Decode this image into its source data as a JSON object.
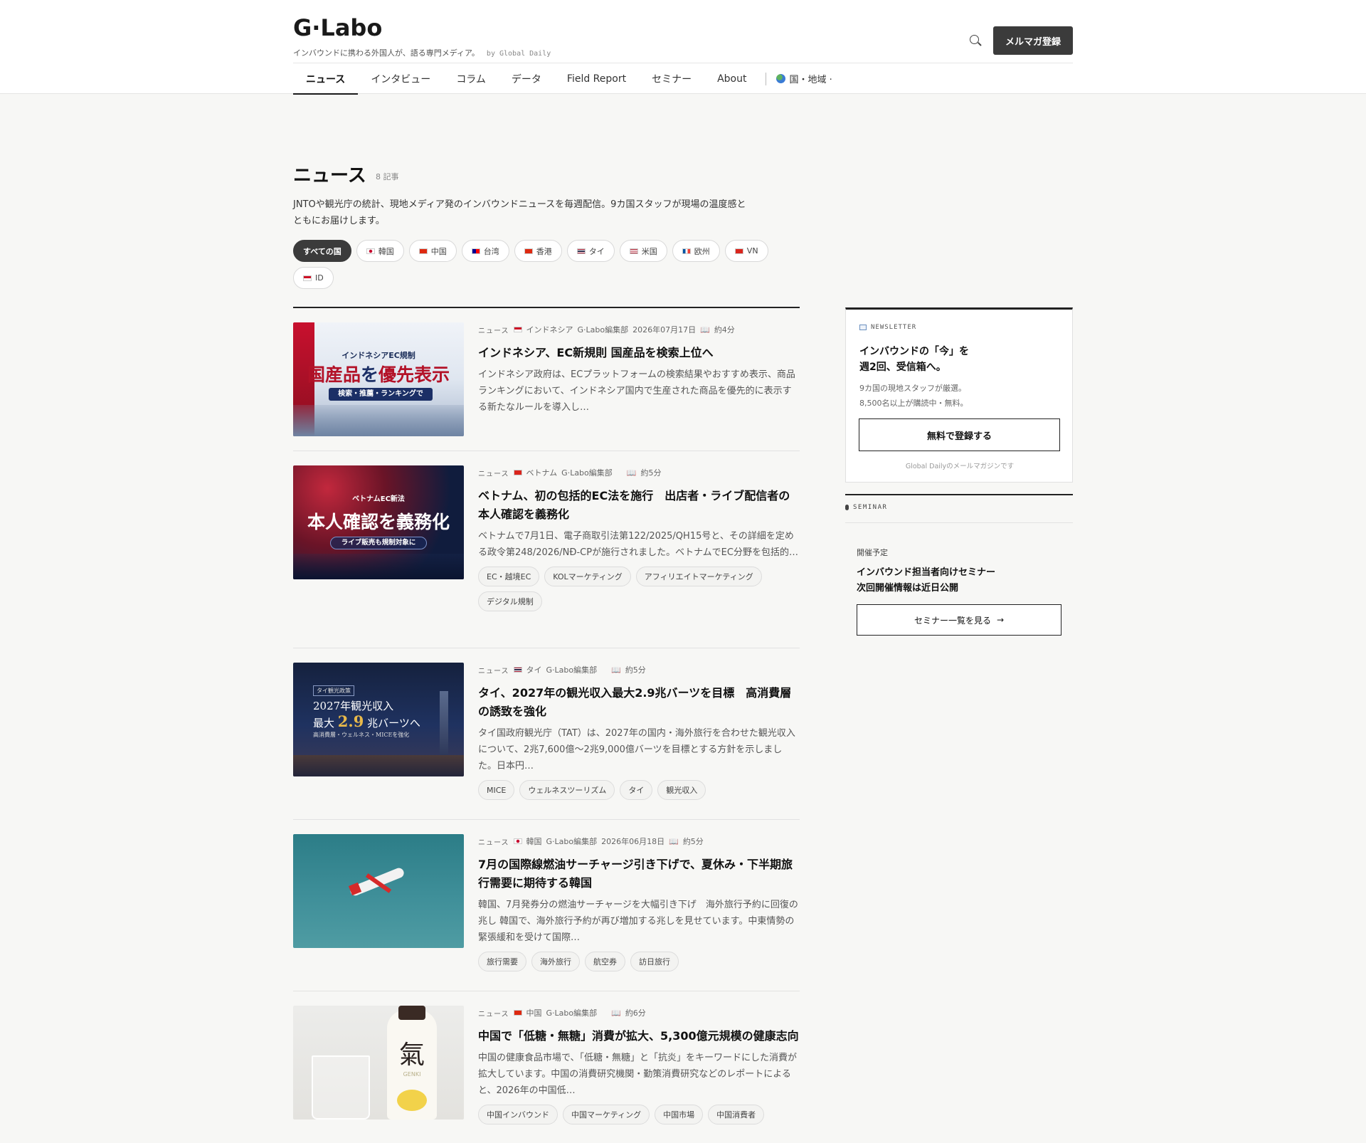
{
  "header": {
    "logo": "G·Labo",
    "tagline": "インバウンドに携わる外国人が、語る専門メディア。",
    "tagline_by": "by Global Daily",
    "search_icon": "search-icon",
    "subscribe_label": "メルマガ登録"
  },
  "nav": {
    "items": [
      "ニュース",
      "インタビュー",
      "コラム",
      "データ",
      "Field Report",
      "セミナー",
      "About"
    ],
    "active": "ニュース",
    "region_label": "国・地域 ·"
  },
  "section": {
    "title": "ニュース",
    "count": "8 記事",
    "description": "JNTOや観光庁の統計、現地メディア発のインバウンドニュースを毎週配信。9カ国スタッフが現場の温度感とともにお届けします。"
  },
  "filters": [
    {
      "label": "すべての国",
      "flag": null,
      "active": true
    },
    {
      "label": "韓国",
      "flag": "kr"
    },
    {
      "label": "中国",
      "flag": "cn"
    },
    {
      "label": "台湾",
      "flag": "tw"
    },
    {
      "label": "香港",
      "flag": "hk"
    },
    {
      "label": "タイ",
      "flag": "th"
    },
    {
      "label": "米国",
      "flag": "us"
    },
    {
      "label": "欧州",
      "flag": "eu"
    },
    {
      "label": "VN",
      "flag": "vn"
    },
    {
      "label": "ID",
      "flag": "id"
    }
  ],
  "articles": [
    {
      "category": "ニュース",
      "country": "インドネシア",
      "flag": "id",
      "author": "G·Labo編集部",
      "date": "2026年07月17日",
      "read_time": "約4分",
      "title": "インドネシア、EC新規則 国産品を検索上位へ",
      "excerpt": "インドネシア政府は、ECプラットフォームの検索結果やおすすめ表示、商品ランキングにおいて、インドネシア国内で生産された商品を優先的に表示する新たなルールを導入し…",
      "thumb": {
        "small": "インドネシアEC規制",
        "big_a": "国産品",
        "big_b": "を",
        "big_c": "優先表示",
        "pill": "検索・推薦・ランキングで"
      },
      "tags": []
    },
    {
      "category": "ニュース",
      "country": "ベトナム",
      "flag": "vn",
      "author": "G·Labo編集部",
      "date": "",
      "read_time": "約5分",
      "title": "ベトナム、初の包括的EC法を施行　出店者・ライブ配信者の本人確認を義務化",
      "excerpt": "ベトナムで7月1日、電子商取引法第122/2025/QH15号と、その詳細を定める政令第248/2026/NĐ-CPが施行されました。ベトナムでEC分野を包括的…",
      "thumb": {
        "small": "ベトナムEC新法",
        "big": "本人確認を義務化",
        "pill": "ライブ販売も規制対象に"
      },
      "tags": [
        "EC・越境EC",
        "KOLマーケティング",
        "アフィリエイトマーケティング",
        "デジタル規制"
      ]
    },
    {
      "category": "ニュース",
      "country": "タイ",
      "flag": "th",
      "author": "G·Labo編集部",
      "date": "",
      "read_time": "約5分",
      "title": "タイ、2027年の観光収入最大2.9兆バーツを目標　高消費層の誘致を強化",
      "excerpt": "タイ国政府観光庁（TAT）は、2027年の国内・海外旅行を合わせた観光収入について、2兆7,600億〜2兆9,000億バーツを目標とする方針を示しました。日本円…",
      "thumb": {
        "badge": "タイ観光政策",
        "l1": "2027年観光収入",
        "l2a": "最大",
        "l2b": "2.9",
        "l2c": "兆バーツへ",
        "l3": "高消費層・ウェルネス・MICEを強化"
      },
      "tags": [
        "MICE",
        "ウェルネスツーリズム",
        "タイ",
        "観光収入"
      ]
    },
    {
      "category": "ニュース",
      "country": "韓国",
      "flag": "kr",
      "author": "G·Labo編集部",
      "date": "2026年06月18日",
      "read_time": "約5分",
      "title": "7月の国際線燃油サーチャージ引き下げで、夏休み・下半期旅行需要に期待する韓国",
      "excerpt": "韓国、7月発券分の燃油サーチャージを大幅引き下げ　海外旅行予約に回復の兆し 韓国で、海外旅行予約が再び増加する兆しを見せています。中東情勢の緊張緩和を受けて国際…",
      "thumb": {},
      "tags": [
        "旅行需要",
        "海外旅行",
        "航空券",
        "訪日旅行"
      ]
    },
    {
      "category": "ニュース",
      "country": "中国",
      "flag": "cn",
      "author": "G·Labo編集部",
      "date": "",
      "read_time": "約6分",
      "title": "中国で「低糖・無糖」消費が拡大、5,300億元規模の健康志向",
      "excerpt": "中国の健康食品市場で、「低糖・無糖」と「抗炎」をキーワードにした消費が拡大しています。中国の消費研究機関・勤策消費研究などのレポートによると、2026年の中国低…",
      "thumb": {
        "kanji": "氣",
        "brand": "GENKI"
      },
      "tags": [
        "中国インバウンド",
        "中国マーケティング",
        "中国市場",
        "中国消費者"
      ]
    }
  ],
  "sidebar": {
    "newsletter": {
      "kicker": "NEWSLETTER",
      "title_line1": "インバウンドの「今」を",
      "title_line2": "週2回、受信箱へ。",
      "desc_line1": "9カ国の現地スタッフが厳選。",
      "desc_line2": "8,500名以上が購読中・無料。",
      "button": "無料で登録する",
      "note": "Global Dailyのメールマガジンです"
    },
    "seminar": {
      "kicker": "SEMINAR",
      "status": "開催予定",
      "title_line1": "インバウンド担当者向けセミナー",
      "title_line2": "次回開催情報は近日公開",
      "button": "セミナー一覧を見る",
      "arrow": "→"
    }
  },
  "colors": {
    "primary_dark": "#3b3b3b",
    "background": "#f7f7f5",
    "flag_id": "#ce1126",
    "flag_vn": "#da251d",
    "flag_kr": "#ffffff",
    "flag_cn": "#de2910",
    "flag_th": "#2d2a4a"
  }
}
